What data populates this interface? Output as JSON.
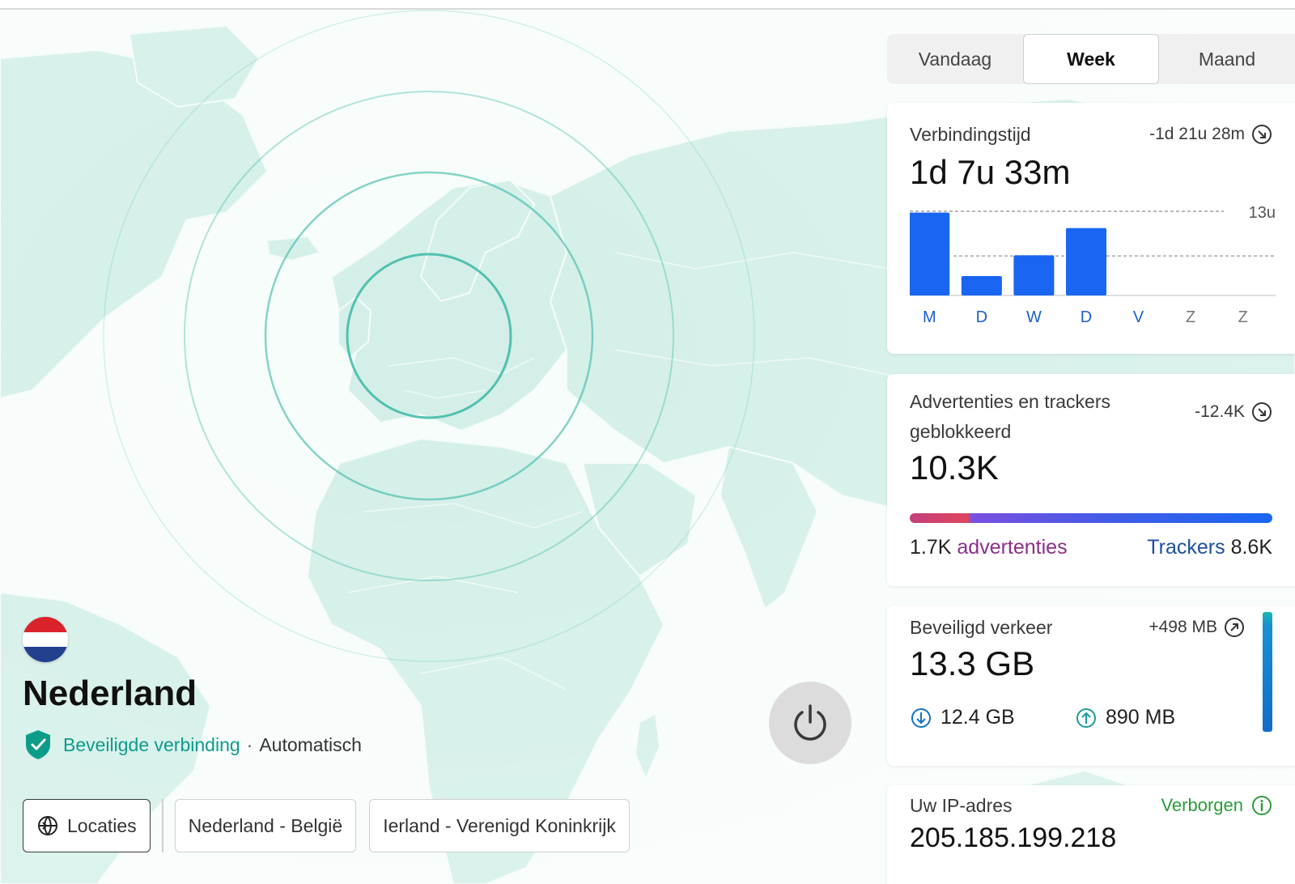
{
  "colors": {
    "accent": "#1a66f2",
    "secure": "#0e9c8a",
    "hidden": "#2b9c3b",
    "ads": "#8a2f86",
    "trackers": "#1e4f9c"
  },
  "location": {
    "flag_icon": "netherlands-flag-icon",
    "country": "Nederland",
    "status": "Beveiligde verbinding",
    "separator": "·",
    "mode": "Automatisch"
  },
  "chips": {
    "locations_label": "Locaties",
    "recent_1": "Nederland - België",
    "recent_2": "Ierland - Verenigd Koninkrijk"
  },
  "tabs": {
    "today": "Vandaag",
    "week": "Week",
    "month": "Maand",
    "selected": "Week"
  },
  "connection": {
    "title": "Verbindingstijd",
    "delta": "-1d 21u 28m",
    "value": "1d 7u 33m"
  },
  "chart_data": {
    "type": "bar",
    "categories": [
      "M",
      "D",
      "W",
      "D",
      "V",
      "Z",
      "Z"
    ],
    "values": [
      12.8,
      3.0,
      6.2,
      10.4,
      0,
      0,
      0
    ],
    "ylim": [
      0,
      13
    ],
    "max_label": "13u",
    "average": 6.1,
    "active_days": 5
  },
  "ads": {
    "title": "Advertenties en trackers geblokkeerd",
    "delta": "-12.4K",
    "value": "10.3K",
    "ads_count": "1.7K",
    "ads_label": "advertenties",
    "trackers_label": "Trackers",
    "trackers_count": "8.6K"
  },
  "traffic": {
    "title": "Beveiligd verkeer",
    "delta": "+498 MB",
    "value": "13.3 GB",
    "download": "12.4 GB",
    "upload": "890 MB"
  },
  "ip": {
    "title": "Uw IP-adres",
    "status": "Verborgen",
    "value": "205.185.199.218"
  }
}
